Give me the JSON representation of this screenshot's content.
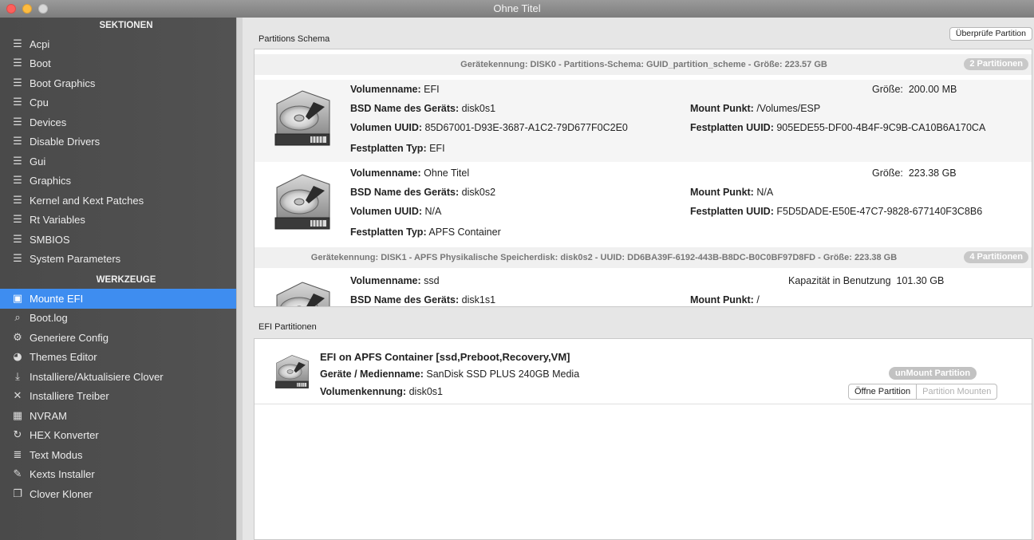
{
  "window": {
    "title": "Ohne Titel"
  },
  "sidebar": {
    "sections_header": "SEKTIONEN",
    "sections": [
      {
        "label": "Acpi",
        "icon": "list-icon"
      },
      {
        "label": "Boot",
        "icon": "list-icon"
      },
      {
        "label": "Boot Graphics",
        "icon": "list-icon"
      },
      {
        "label": "Cpu",
        "icon": "list-icon"
      },
      {
        "label": "Devices",
        "icon": "list-icon"
      },
      {
        "label": "Disable Drivers",
        "icon": "list-icon"
      },
      {
        "label": "Gui",
        "icon": "list-icon"
      },
      {
        "label": "Graphics",
        "icon": "list-icon"
      },
      {
        "label": "Kernel and Kext Patches",
        "icon": "list-icon"
      },
      {
        "label": "Rt Variables",
        "icon": "list-icon"
      },
      {
        "label": "SMBIOS",
        "icon": "list-icon"
      },
      {
        "label": "System Parameters",
        "icon": "list-icon"
      }
    ],
    "tools_header": "WERKZEUGE",
    "tools": [
      {
        "label": "Mounte EFI",
        "icon": "disk-icon",
        "selected": true
      },
      {
        "label": "Boot.log",
        "icon": "log-search-icon"
      },
      {
        "label": "Generiere Config",
        "icon": "gears-icon"
      },
      {
        "label": "Themes Editor",
        "icon": "palette-icon"
      },
      {
        "label": "Installiere/Aktualisiere Clover",
        "icon": "download-icon"
      },
      {
        "label": "Installiere Treiber",
        "icon": "tools-icon"
      },
      {
        "label": "NVRAM",
        "icon": "chip-icon"
      },
      {
        "label": "HEX Konverter",
        "icon": "refresh-icon"
      },
      {
        "label": "Text Modus",
        "icon": "text-icon"
      },
      {
        "label": "Kexts Installer",
        "icon": "wand-icon"
      },
      {
        "label": "Clover Kloner",
        "icon": "clone-icon"
      }
    ]
  },
  "main": {
    "verify_button": "Überprüfe Partition",
    "schema_label": "Partitions Schema",
    "efi_label": "EFI Partitionen",
    "disk0": {
      "header": "Gerätekennung: DISK0 - Partitions-Schema: GUID_partition_scheme - Größe: 223.57 GB",
      "badge": "2 Partitionen"
    },
    "disk1": {
      "header": "Gerätekennung: DISK1 - APFS Physikalische Speicherdisk: disk0s2 - UUID: DD6BA39F-6192-443B-B8DC-B0C0BF97D8FD - Größe: 223.38 GB",
      "badge": "4 Partitionen"
    },
    "labels": {
      "volname": "Volumenname:",
      "bsd": "BSD Name des Geräts:",
      "vuuid": "Volumen UUID:",
      "ptype": "Festplatten Typ:",
      "size": "Größe:",
      "mount": "Mount Punkt:",
      "duuid": "Festplatten UUID:",
      "capacity": "Kapazität in Benutzung"
    },
    "volumes": [
      {
        "name": "EFI",
        "bsd": "disk0s1",
        "vuuid": "85D67001-D93E-3687-A1C2-79D677F0C2E0",
        "type": "EFI",
        "size": "200.00 MB",
        "mount": "/Volumes/ESP",
        "duuid": "905EDE55-DF00-4B4F-9C9B-CA10B6A170CA"
      },
      {
        "name": "Ohne Titel",
        "bsd": "disk0s2",
        "vuuid": "N/A",
        "type": "APFS Container",
        "size": "223.38 GB",
        "mount": "N/A",
        "duuid": "F5D5DADE-E50E-47C7-9828-677140F3C8B6"
      },
      {
        "name": "ssd",
        "bsd": "disk1s1",
        "capacity": "101.30 GB",
        "mount": "/"
      }
    ],
    "efi_entry": {
      "title": "EFI on APFS Container [ssd,Preboot,Recovery,VM]",
      "media_label": "Geräte / Medienname:",
      "media_value": "SanDisk SSD PLUS 240GB Media",
      "vol_label": "Volumenkennung:",
      "vol_value": "disk0s1",
      "unmount": "unMount Partition",
      "open": "Öffne Partition",
      "mount": "Partition Mounten"
    }
  }
}
